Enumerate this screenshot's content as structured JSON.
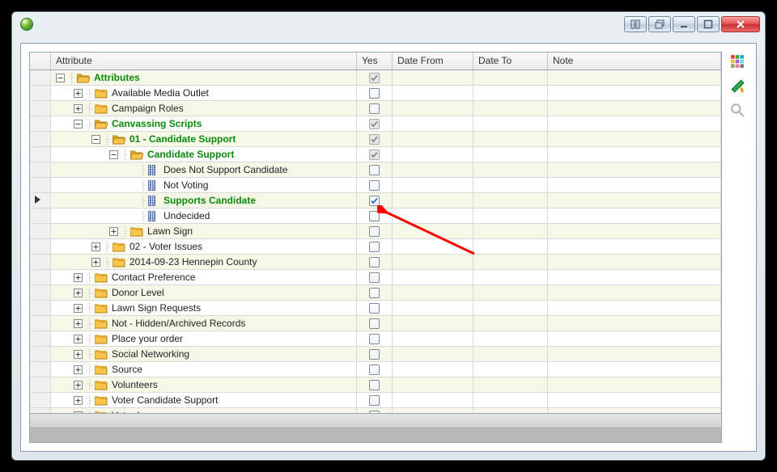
{
  "columns": {
    "attribute": "Attribute",
    "yes": "Yes",
    "date_from": "Date From",
    "date_to": "Date To",
    "note": "Note"
  },
  "side_tools": [
    {
      "name": "color-grid",
      "label": "Color chooser"
    },
    {
      "name": "paint-fill",
      "label": "Fill"
    },
    {
      "name": "search",
      "label": "Search"
    }
  ],
  "rows": [
    {
      "level": 0,
      "expander": "minus",
      "icon": "folder-open",
      "label": "Attributes",
      "green": true,
      "yes": "checked-disabled"
    },
    {
      "level": 1,
      "expander": "plus",
      "icon": "folder",
      "label": "Available Media Outlet",
      "green": false,
      "yes": "empty"
    },
    {
      "level": 1,
      "expander": "plus",
      "icon": "folder",
      "label": "Campaign Roles",
      "green": false,
      "yes": "empty"
    },
    {
      "level": 1,
      "expander": "minus",
      "icon": "folder-open",
      "label": "Canvassing Scripts",
      "green": true,
      "yes": "checked-disabled"
    },
    {
      "level": 2,
      "expander": "minus",
      "icon": "folder-open",
      "label": "01 - Candidate Support",
      "green": true,
      "yes": "checked-disabled"
    },
    {
      "level": 3,
      "expander": "minus",
      "icon": "folder-open",
      "label": "Candidate Support",
      "green": true,
      "yes": "checked-disabled"
    },
    {
      "level": 4,
      "expander": "none",
      "icon": "item",
      "label": "Does Not Support Candidate",
      "green": false,
      "yes": "empty"
    },
    {
      "level": 4,
      "expander": "none",
      "icon": "item",
      "label": "Not Voting",
      "green": false,
      "yes": "empty"
    },
    {
      "level": 4,
      "expander": "none",
      "icon": "item",
      "label": "Supports Candidate",
      "green": true,
      "yes": "checked",
      "selected": true
    },
    {
      "level": 4,
      "expander": "none",
      "icon": "item",
      "label": "Undecided",
      "green": false,
      "yes": "empty"
    },
    {
      "level": 3,
      "expander": "plus",
      "icon": "folder",
      "label": "Lawn Sign",
      "green": false,
      "yes": "empty"
    },
    {
      "level": 2,
      "expander": "plus",
      "icon": "folder",
      "label": "02 - Voter Issues",
      "green": false,
      "yes": "empty"
    },
    {
      "level": 2,
      "expander": "plus",
      "icon": "folder",
      "label": "2014-09-23 Hennepin County",
      "green": false,
      "yes": "empty"
    },
    {
      "level": 1,
      "expander": "plus",
      "icon": "folder",
      "label": "Contact Preference",
      "green": false,
      "yes": "empty"
    },
    {
      "level": 1,
      "expander": "plus",
      "icon": "folder",
      "label": "Donor Level",
      "green": false,
      "yes": "empty"
    },
    {
      "level": 1,
      "expander": "plus",
      "icon": "folder",
      "label": "Lawn Sign Requests",
      "green": false,
      "yes": "empty"
    },
    {
      "level": 1,
      "expander": "plus",
      "icon": "folder",
      "label": "Not - Hidden/Archived Records",
      "green": false,
      "yes": "empty"
    },
    {
      "level": 1,
      "expander": "plus",
      "icon": "folder",
      "label": "Place your order",
      "green": false,
      "yes": "empty"
    },
    {
      "level": 1,
      "expander": "plus",
      "icon": "folder",
      "label": "Social Networking",
      "green": false,
      "yes": "empty"
    },
    {
      "level": 1,
      "expander": "plus",
      "icon": "folder",
      "label": "Source",
      "green": false,
      "yes": "empty"
    },
    {
      "level": 1,
      "expander": "plus",
      "icon": "folder",
      "label": "Volunteers",
      "green": false,
      "yes": "empty"
    },
    {
      "level": 1,
      "expander": "plus",
      "icon": "folder",
      "label": "Voter Candidate Support",
      "green": false,
      "yes": "empty"
    },
    {
      "level": 1,
      "expander": "plus",
      "icon": "folder",
      "label": "Voter Issues",
      "green": false,
      "yes": "empty"
    }
  ],
  "annotation": {
    "kind": "arrow",
    "color": "#ff0000"
  }
}
